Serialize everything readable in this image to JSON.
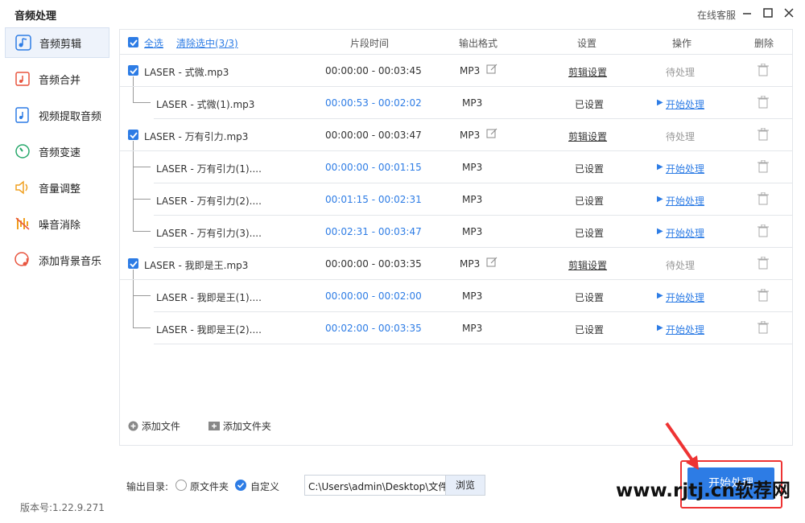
{
  "app": {
    "title": "音频处理",
    "support": "在线客服"
  },
  "sidebar": {
    "items": [
      {
        "label": "音频剪辑",
        "icon": "scissors-music-icon",
        "active": true
      },
      {
        "label": "音频合并",
        "icon": "merge-audio-icon"
      },
      {
        "label": "视频提取音频",
        "icon": "video-extract-audio-icon"
      },
      {
        "label": "音频变速",
        "icon": "speed-icon"
      },
      {
        "label": "音量调整",
        "icon": "volume-icon"
      },
      {
        "label": "噪音消除",
        "icon": "noise-reduction-icon"
      },
      {
        "label": "添加背景音乐",
        "icon": "background-music-icon"
      }
    ],
    "version": "版本号:1.22.9.271"
  },
  "table": {
    "select_all": "全选",
    "clear_selected": "清除选中(3/3)",
    "headers": {
      "segment_time": "片段时间",
      "output_format": "输出格式",
      "settings": "设置",
      "actions": "操作",
      "delete": "删除"
    },
    "rows": [
      {
        "type": "parent",
        "name": "LASER - 式微.mp3",
        "time": "00:00:00 - 00:03:45",
        "format": "MP3",
        "setting": "剪辑设置",
        "action": "待处理"
      },
      {
        "type": "child",
        "name": "LASER - 式微(1).mp3",
        "time": "00:00:53 - 00:02:02",
        "format": "MP3",
        "setting": "已设置",
        "action": "开始处理"
      },
      {
        "type": "parent",
        "name": "LASER - 万有引力.mp3",
        "time": "00:00:00 - 00:03:47",
        "format": "MP3",
        "setting": "剪辑设置",
        "action": "待处理"
      },
      {
        "type": "child",
        "name": "LASER - 万有引力(1)....",
        "time": "00:00:00 - 00:01:15",
        "format": "MP3",
        "setting": "已设置",
        "action": "开始处理"
      },
      {
        "type": "child",
        "name": "LASER - 万有引力(2)....",
        "time": "00:01:15 - 00:02:31",
        "format": "MP3",
        "setting": "已设置",
        "action": "开始处理"
      },
      {
        "type": "child",
        "name": "LASER - 万有引力(3)....",
        "time": "00:02:31 - 00:03:47",
        "format": "MP3",
        "setting": "已设置",
        "action": "开始处理"
      },
      {
        "type": "parent",
        "name": "LASER - 我即是王.mp3",
        "time": "00:00:00 - 00:03:35",
        "format": "MP3",
        "setting": "剪辑设置",
        "action": "待处理"
      },
      {
        "type": "child",
        "name": "LASER - 我即是王(1)....",
        "time": "00:00:00 - 00:02:00",
        "format": "MP3",
        "setting": "已设置",
        "action": "开始处理"
      },
      {
        "type": "child",
        "name": "LASER - 我即是王(2)....",
        "time": "00:02:00 - 00:03:35",
        "format": "MP3",
        "setting": "已设置",
        "action": "开始处理"
      }
    ],
    "add_file": "添加文件",
    "add_folder": "添加文件夹"
  },
  "output": {
    "label": "输出目录:",
    "option_original": "原文件夹",
    "option_custom": "自定义",
    "selected": "自定义",
    "path": "C:\\Users\\admin\\Desktop\\文件",
    "browse": "浏览"
  },
  "start_button": "开始处理",
  "watermark": "www.rjtj.cn软荐网",
  "colors": {
    "accent": "#2d7ce5",
    "highlight": "#e33333"
  }
}
